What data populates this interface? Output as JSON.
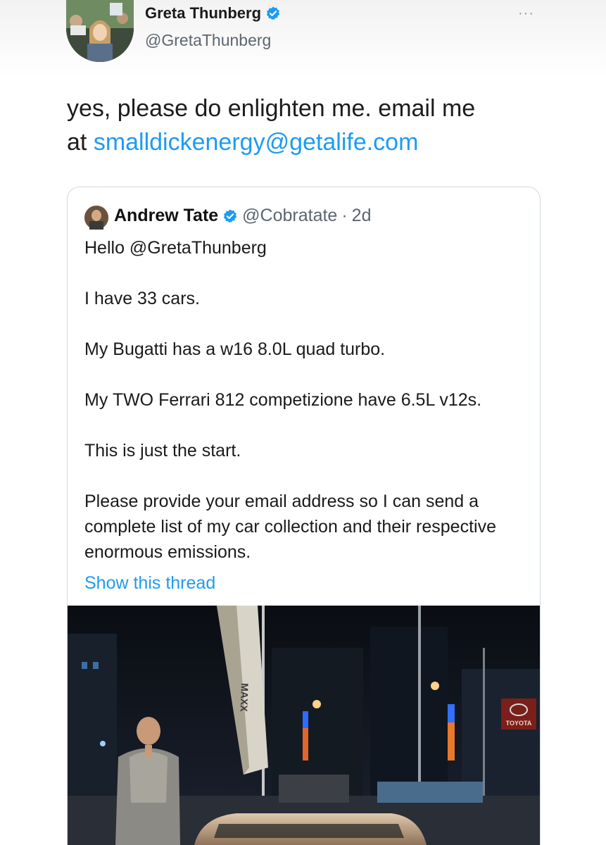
{
  "main_tweet": {
    "author_name": "Greta Thunberg",
    "author_handle": "@GretaThunberg",
    "more_icon": "more-dots-icon",
    "verified_icon": "verified-badge-icon",
    "text_line1": "yes, please do enlighten me. email me",
    "text_prefix": "at ",
    "text_link": "smalldickenergy@getalife.com"
  },
  "quoted_tweet": {
    "author_name": "Andrew Tate",
    "author_handle": "@Cobratate",
    "separator": "·",
    "time": "2d",
    "lines": [
      "Hello @GretaThunberg",
      "I have 33 cars.",
      "My Bugatti has a w16 8.0L quad turbo.",
      "My TWO Ferrari 812 competizione have 6.5L v12s.",
      "This is just the start.",
      "Please provide your email address so I can send a complete list of my car collection and their respective enormous emissions."
    ],
    "show_thread": "Show this thread",
    "photo": {
      "flag_text": "MAXX",
      "sign_text": "TOYOTA"
    }
  },
  "colors": {
    "link": "#1d9bf0",
    "verified": "#1d9bf0",
    "border": "#cfd9de",
    "secondary_text": "#5b6670"
  }
}
